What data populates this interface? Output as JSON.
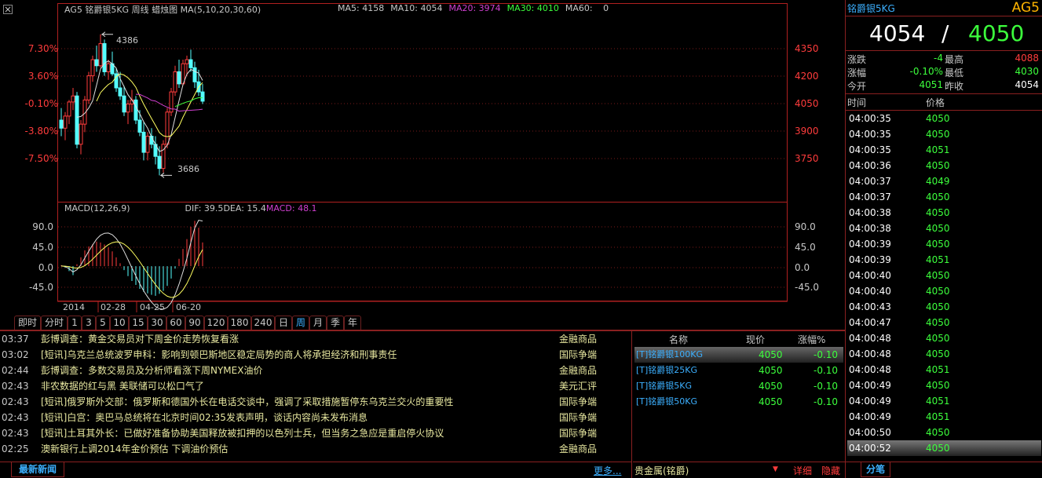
{
  "chart": {
    "header": "AG5 铭爵银5KG 周线  蜡烛图 MA(5,10,20,30,60)",
    "ma_labels": [
      {
        "label": "MA5:",
        "value": "4158",
        "color": "#c8c8c8"
      },
      {
        "label": "MA10:",
        "value": "4054",
        "color": "#c8c8c8"
      },
      {
        "label": "MA20:",
        "value": "3974",
        "color": "#d040d0"
      },
      {
        "label": "MA30:",
        "value": "4010",
        "color": "#3cff3c"
      },
      {
        "label": "MA60:",
        "value": "0",
        "color": "#c8c8c8"
      }
    ],
    "left_ticks": [
      "7.30%",
      "3.60%",
      "-0.10%",
      "-3.80%",
      "-7.50%"
    ],
    "right_ticks": [
      "4350",
      "4200",
      "4050",
      "3900",
      "3750"
    ],
    "peak_high": "4386",
    "peak_low": "3686",
    "macd_header": {
      "label": "MACD(12,26,9)",
      "dif": "DIF:  39.5",
      "dea": "DEA:  15.4",
      "macd": "MACD:  48.1"
    },
    "macd_ticks": [
      "90.0",
      "45.0",
      "0.0",
      "-45.0"
    ],
    "x_dates": [
      "2014",
      "02-28",
      "04-25",
      "06-20"
    ]
  },
  "chart_data": {
    "type": "candlestick",
    "title": "AG5 铭爵银5KG 周线",
    "ylim": [
      3660,
      4420
    ],
    "candles": [
      [
        3960,
        4020,
        3880,
        3920
      ],
      [
        3920,
        4000,
        3860,
        3980
      ],
      [
        3980,
        4060,
        3940,
        4050
      ],
      [
        4050,
        4120,
        4010,
        4080
      ],
      [
        4080,
        4100,
        3820,
        3840
      ],
      [
        3840,
        3960,
        3790,
        3940
      ],
      [
        3940,
        4080,
        3900,
        4060
      ],
      [
        4060,
        4200,
        4040,
        4180
      ],
      [
        4180,
        4280,
        4150,
        4260
      ],
      [
        4260,
        4330,
        4200,
        4230
      ],
      [
        4230,
        4386,
        4220,
        4340
      ],
      [
        4340,
        4360,
        4180,
        4200
      ],
      [
        4200,
        4260,
        4160,
        4240
      ],
      [
        4240,
        4300,
        4180,
        4190
      ],
      [
        4190,
        4220,
        4100,
        4120
      ],
      [
        4120,
        4200,
        4060,
        4080
      ],
      [
        4080,
        4130,
        3980,
        4000
      ],
      [
        4000,
        4060,
        3940,
        4040
      ],
      [
        4040,
        4110,
        4000,
        4060
      ],
      [
        4060,
        4080,
        3940,
        3960
      ],
      [
        3960,
        4010,
        3880,
        3900
      ],
      [
        3900,
        3950,
        3760,
        3800
      ],
      [
        3800,
        3900,
        3760,
        3880
      ],
      [
        3880,
        3920,
        3820,
        3840
      ],
      [
        3840,
        3880,
        3740,
        3780
      ],
      [
        3780,
        3830,
        3686,
        3720
      ],
      [
        3720,
        3860,
        3700,
        3840
      ],
      [
        3840,
        4020,
        3820,
        4000
      ],
      [
        4000,
        4120,
        3980,
        4100
      ],
      [
        4100,
        4230,
        4080,
        4200
      ],
      [
        4200,
        4260,
        4120,
        4140
      ],
      [
        4140,
        4260,
        4130,
        4240
      ],
      [
        4240,
        4280,
        4180,
        4260
      ],
      [
        4260,
        4310,
        4200,
        4220
      ],
      [
        4220,
        4250,
        4120,
        4150
      ],
      [
        4150,
        4210,
        4080,
        4100
      ],
      [
        4100,
        4140,
        4040,
        4054
      ]
    ],
    "macd_ylim": [
      -65,
      110
    ],
    "macd_hist": [
      2,
      -3,
      -10,
      -18,
      4,
      18,
      32,
      40,
      45,
      50,
      48,
      44,
      38,
      30,
      18,
      6,
      -8,
      -20,
      -30,
      -38,
      -46,
      -52,
      -55,
      -58,
      -60,
      -56,
      -50,
      -40,
      -25,
      -5,
      15,
      35,
      55,
      80,
      92,
      78,
      48.1
    ]
  },
  "period_tabs": [
    "即时",
    "分时",
    "1",
    "3",
    "5",
    "10",
    "15",
    "30",
    "60",
    "90",
    "120",
    "180",
    "240",
    "日",
    "周",
    "月",
    "季",
    "年"
  ],
  "active_tab": "周",
  "news": [
    {
      "time": "03:37",
      "text": "彭博调查：黄金交易员对下周金价走势恢复看涨",
      "cat": "金融商品"
    },
    {
      "time": "03:02",
      "text": "[短讯]乌克兰总统波罗申科：影响到顿巴斯地区稳定局势的商人将承担经济和刑事责任",
      "cat": "国际争端"
    },
    {
      "time": "02:44",
      "text": "彭博调查：多数交易员及分析师看涨下周NYMEX油价",
      "cat": "金融商品"
    },
    {
      "time": "02:43",
      "text": "非农数据的红与黑 美联储可以松口气了",
      "cat": "美元汇评"
    },
    {
      "time": "02:43",
      "text": "[短讯]俄罗斯外交部：俄罗斯和德国外长在电话交谈中，强调了采取措施暂停东乌克兰交火的重要性",
      "cat": "国际争端"
    },
    {
      "time": "02:43",
      "text": "[短讯]白宫：奥巴马总统将在北京时间02:35发表声明，谈话内容尚未发布消息",
      "cat": "国际争端"
    },
    {
      "time": "02:43",
      "text": "[短讯]土耳其外长：已做好准备协助美国释放被扣押的以色列士兵，但当务之急应是重启停火协议",
      "cat": "国际争端"
    },
    {
      "time": "02:25",
      "text": "澳新银行上调2014年金价预估 下调油价预估",
      "cat": "金融商品"
    }
  ],
  "news_tab": "最新新闻",
  "more_link": "更多...",
  "quote_table": {
    "headers": [
      "名称",
      "现价",
      "涨幅%"
    ],
    "rows": [
      {
        "name": "[T]铭爵银100KG",
        "price": "4050",
        "chg": "-0.10"
      },
      {
        "name": "[T]铭爵银25KG",
        "price": "4050",
        "chg": "-0.10"
      },
      {
        "name": "[T]铭爵银5KG",
        "price": "4050",
        "chg": "-0.10"
      },
      {
        "name": "[T]铭爵银50KG",
        "price": "4050",
        "chg": "-0.10"
      }
    ],
    "footer": "贵金属(铭爵)",
    "footer_links": [
      "详细",
      "隐藏"
    ]
  },
  "right_panel": {
    "title": "铭爵银5KG",
    "code": "AG5",
    "price_a": "4054",
    "slash": "/",
    "price_b": "4050",
    "stats": [
      {
        "l1": "涨跌",
        "v1": "-4",
        "l2": "最高",
        "v2": "4088",
        "c1": "#3cff3c",
        "c2": "#ff3c3c"
      },
      {
        "l1": "涨幅",
        "v1": "-0.10%",
        "l2": "最低",
        "v2": "4030",
        "c1": "#3cff3c",
        "c2": "#3cff3c"
      },
      {
        "l1": "今开",
        "v1": "4051",
        "l2": "昨收",
        "v2": "4054",
        "c1": "#3cff3c",
        "c2": "#ffffff"
      }
    ],
    "tick_headers": [
      "时间",
      "价格"
    ],
    "ticks": [
      {
        "t": "04:00:35",
        "p": "4050"
      },
      {
        "t": "04:00:35",
        "p": "4050"
      },
      {
        "t": "04:00:35",
        "p": "4051"
      },
      {
        "t": "04:00:36",
        "p": "4050"
      },
      {
        "t": "04:00:37",
        "p": "4049"
      },
      {
        "t": "04:00:37",
        "p": "4050"
      },
      {
        "t": "04:00:38",
        "p": "4050"
      },
      {
        "t": "04:00:38",
        "p": "4050"
      },
      {
        "t": "04:00:39",
        "p": "4050"
      },
      {
        "t": "04:00:39",
        "p": "4051"
      },
      {
        "t": "04:00:40",
        "p": "4050"
      },
      {
        "t": "04:00:40",
        "p": "4050"
      },
      {
        "t": "04:00:43",
        "p": "4050"
      },
      {
        "t": "04:00:47",
        "p": "4050"
      },
      {
        "t": "04:00:48",
        "p": "4050"
      },
      {
        "t": "04:00:48",
        "p": "4050"
      },
      {
        "t": "04:00:48",
        "p": "4051"
      },
      {
        "t": "04:00:49",
        "p": "4050"
      },
      {
        "t": "04:00:49",
        "p": "4051"
      },
      {
        "t": "04:00:49",
        "p": "4051"
      },
      {
        "t": "04:00:50",
        "p": "4050"
      },
      {
        "t": "04:00:52",
        "p": "4050"
      }
    ],
    "fenbi_tab": "分笔"
  }
}
